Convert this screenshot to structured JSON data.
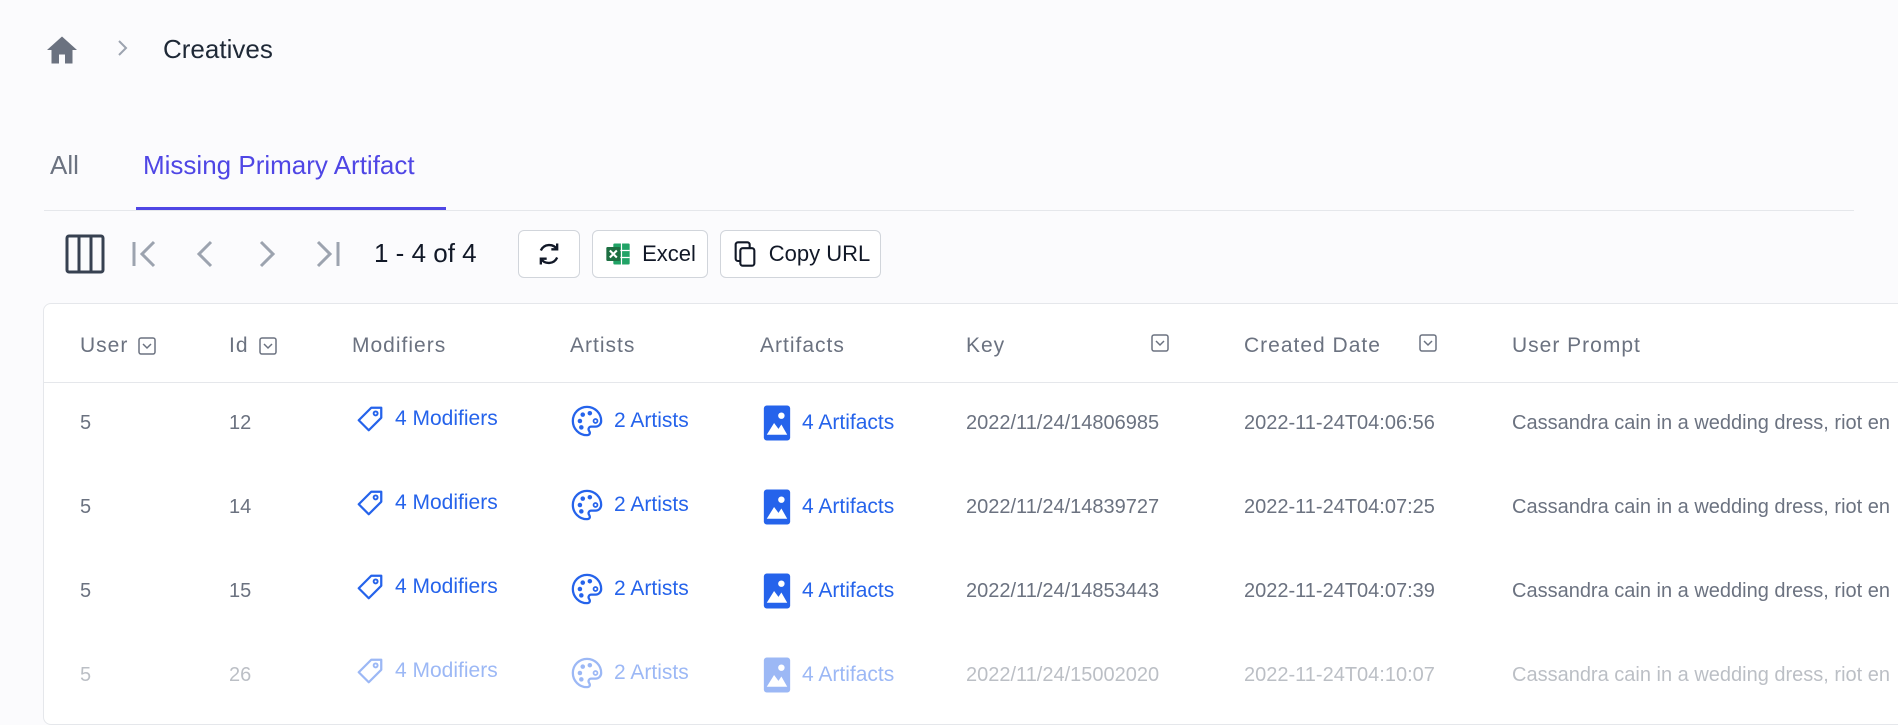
{
  "breadcrumb": {
    "title": "Creatives"
  },
  "tabs": [
    {
      "label": "All",
      "active": false
    },
    {
      "label": "Missing Primary Artifact",
      "active": true
    }
  ],
  "toolbar": {
    "page_count": "1 - 4 of 4",
    "excel_label": "Excel",
    "copy_url_label": "Copy URL"
  },
  "columns": [
    "User",
    "Id",
    "Modifiers",
    "Artists",
    "Artifacts",
    "Key",
    "Created Date",
    "User Prompt"
  ],
  "rows": [
    {
      "user": "5",
      "id": "12",
      "modifiers": "4 Modifiers",
      "artists": "2 Artists",
      "artifacts": "4 Artifacts",
      "key": "2022/11/24/14806985",
      "created": "2022-11-24T04:06:56",
      "prompt": "Cassandra cain in a wedding dress, riot en"
    },
    {
      "user": "5",
      "id": "14",
      "modifiers": "4 Modifiers",
      "artists": "2 Artists",
      "artifacts": "4 Artifacts",
      "key": "2022/11/24/14839727",
      "created": "2022-11-24T04:07:25",
      "prompt": "Cassandra cain in a wedding dress, riot en"
    },
    {
      "user": "5",
      "id": "15",
      "modifiers": "4 Modifiers",
      "artists": "2 Artists",
      "artifacts": "4 Artifacts",
      "key": "2022/11/24/14853443",
      "created": "2022-11-24T04:07:39",
      "prompt": "Cassandra cain in a wedding dress, riot en"
    },
    {
      "user": "5",
      "id": "26",
      "modifiers": "4 Modifiers",
      "artists": "2 Artists",
      "artifacts": "4 Artifacts",
      "key": "2022/11/24/15002020",
      "created": "2022-11-24T04:10:07",
      "prompt": "Cassandra cain in a wedding dress, riot en"
    }
  ],
  "colors": {
    "accent": "#4f46e5",
    "link": "#2563eb",
    "excel_green": "#1d6f42"
  }
}
